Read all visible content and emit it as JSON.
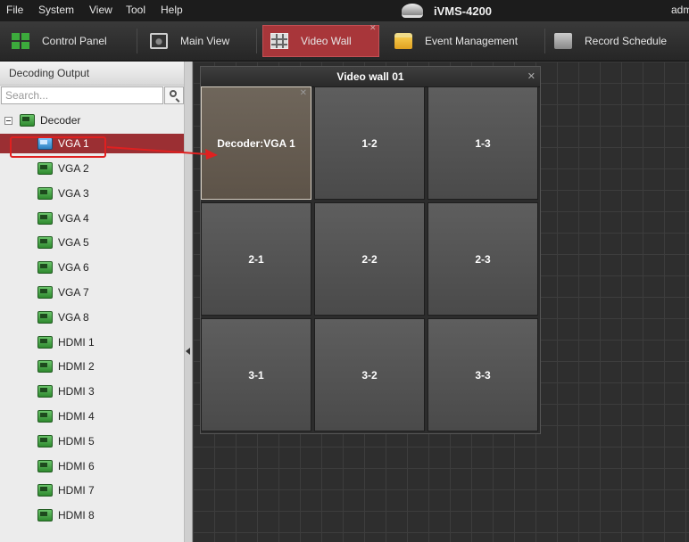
{
  "menu": [
    "File",
    "System",
    "View",
    "Tool",
    "Help"
  ],
  "app_title": "iVMS-4200",
  "user": "adm",
  "toolbar": {
    "control_panel": "Control Panel",
    "main_view": "Main View",
    "video_wall": "Video Wall",
    "event_management": "Event Management",
    "record_schedule": "Record Schedule"
  },
  "left_panel": {
    "title": "Decoding Output",
    "search_placeholder": "Search...",
    "root": "Decoder",
    "items": [
      "VGA 1",
      "VGA 2",
      "VGA 3",
      "VGA 4",
      "VGA 5",
      "VGA 6",
      "VGA 7",
      "VGA 8",
      "HDMI 1",
      "HDMI 2",
      "HDMI 3",
      "HDMI 4",
      "HDMI 5",
      "HDMI 6",
      "HDMI 7",
      "HDMI 8"
    ]
  },
  "video_wall": {
    "title": "Video wall 01",
    "cells": [
      "Decoder:VGA 1",
      "1-2",
      "1-3",
      "2-1",
      "2-2",
      "2-3",
      "3-1",
      "3-2",
      "3-3"
    ]
  },
  "colors": {
    "active_tab": "#a8363a",
    "selected_item": "#9b2f33",
    "highlight_box": "#e02020",
    "drag_arrow": "#e02020"
  }
}
